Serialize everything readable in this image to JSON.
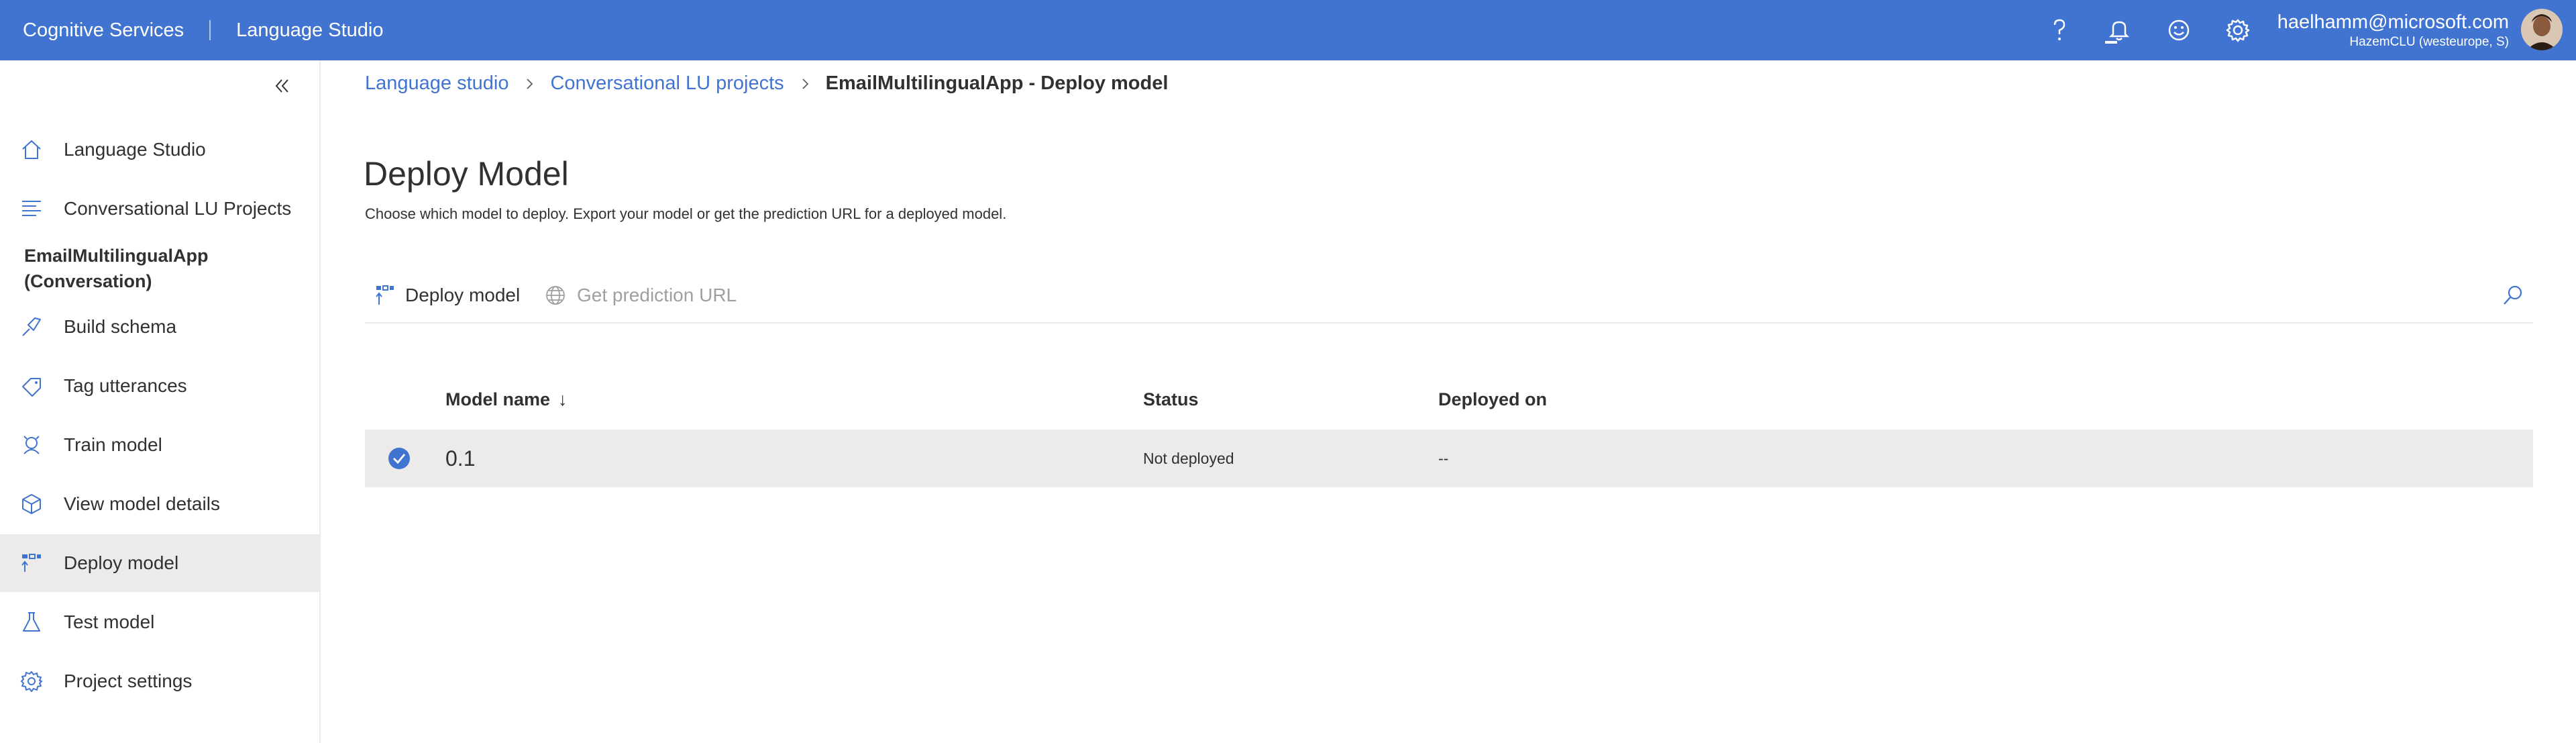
{
  "header": {
    "app_name": "Cognitive Services",
    "product_name": "Language Studio",
    "user_email": "haelhamm@microsoft.com",
    "user_tenant": "HazemCLU (westeurope, S)",
    "brand_color": "#4174d1",
    "icons": [
      "help-icon",
      "notification-icon",
      "feedback-smiley-icon",
      "settings-gear-icon"
    ]
  },
  "sidebar": {
    "items": [
      {
        "label": "Language Studio",
        "icon": "home-icon"
      },
      {
        "label": "Conversational LU Projects",
        "icon": "list-icon"
      },
      {
        "label": "Build schema",
        "icon": "build-icon"
      },
      {
        "label": "Tag utterances",
        "icon": "tag-icon"
      },
      {
        "label": "Train model",
        "icon": "train-icon"
      },
      {
        "label": "View model details",
        "icon": "cube-icon"
      },
      {
        "label": "Deploy model",
        "icon": "deploy-icon"
      },
      {
        "label": "Test model",
        "icon": "flask-icon"
      },
      {
        "label": "Project settings",
        "icon": "gear-icon"
      }
    ],
    "active_item": "Deploy model",
    "project_name_line1": "EmailMultilingualApp",
    "project_name_line2": "(Conversation)"
  },
  "breadcrumb": {
    "items": [
      "Language studio",
      "Conversational LU projects"
    ],
    "current": "EmailMultilingualApp - Deploy model"
  },
  "page": {
    "title": "Deploy Model",
    "description": "Choose which model to deploy. Export your model or get the prediction URL for a deployed model."
  },
  "toolbar": {
    "deploy_label": "Deploy model",
    "prediction_label": "Get prediction URL"
  },
  "table": {
    "columns": [
      "Model name",
      "Status",
      "Deployed on"
    ],
    "sort_indicator": "↓",
    "rows": [
      {
        "model_name": "0.1",
        "status": "Not deployed",
        "deployed_on": "--",
        "selected": true
      }
    ]
  }
}
